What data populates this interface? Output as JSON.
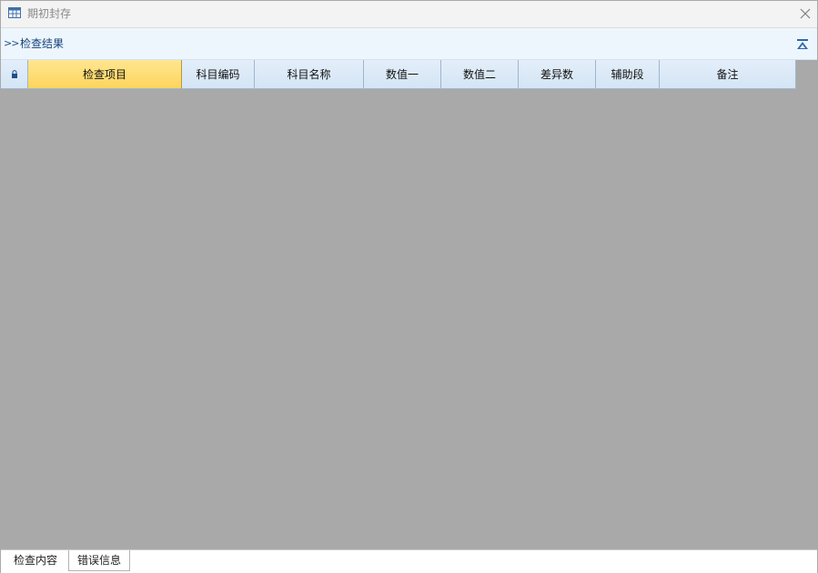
{
  "window": {
    "title": "期初封存"
  },
  "section": {
    "title": "检查结果"
  },
  "grid": {
    "columns": [
      "检查项目",
      "科目编码",
      "科目名称",
      "数值一",
      "数值二",
      "差异数",
      "辅助段",
      "备注"
    ],
    "active_column": "检查项目",
    "rows": []
  },
  "tabs": [
    {
      "label": "检查内容",
      "selected": false
    },
    {
      "label": "错误信息",
      "selected": true
    }
  ],
  "colors": {
    "accent": "#1f4f8b",
    "header_bg": "#d5e5f5",
    "active_header_bg": "#fdd55c",
    "grid_empty_bg": "#a9a9a9"
  }
}
